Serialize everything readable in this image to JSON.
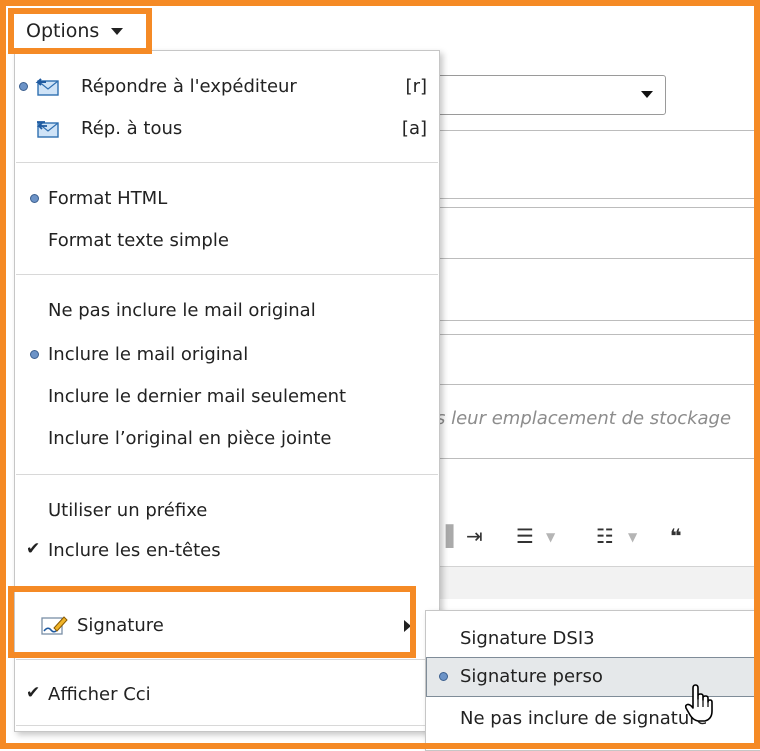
{
  "options_button": {
    "label": "Options"
  },
  "background": {
    "attachments_placeholder": "s leur emplacement de stockage"
  },
  "menu": {
    "reply_sender": {
      "label": "Répondre à l'expéditeur",
      "shortcut": "[r]",
      "selected": true
    },
    "reply_all": {
      "label": "Rép. à tous",
      "shortcut": "[a]"
    },
    "format_html": {
      "label": "Format HTML",
      "selected": true
    },
    "format_text": {
      "label": "Format texte simple"
    },
    "no_include_original": {
      "label": "Ne pas inclure le mail original"
    },
    "include_original": {
      "label": "Inclure le mail original",
      "selected": true
    },
    "include_last": {
      "label": "Inclure le dernier mail seulement"
    },
    "include_attached": {
      "label": "Inclure l’original en pièce jointe"
    },
    "use_prefix": {
      "label": "Utiliser un préfixe"
    },
    "include_headers": {
      "label": "Inclure les en-têtes",
      "checked": true
    },
    "signature": {
      "label": "Signature"
    },
    "show_bcc": {
      "label": "Afficher Cci",
      "checked": true
    }
  },
  "submenu": {
    "sig_dsi3": {
      "label": "Signature DSI3"
    },
    "sig_perso": {
      "label": "Signature perso",
      "selected": true
    },
    "sig_none": {
      "label": "Ne pas inclure de signature"
    }
  },
  "colors": {
    "highlight_frame": "#f58a25",
    "radio_dot": "#6c93c7"
  },
  "icons": {
    "reply_sender": "mail-reply-icon",
    "reply_all": "mail-reply-all-icon",
    "signature": "signature-pen-icon",
    "pointer": "hand-pointer-icon"
  }
}
